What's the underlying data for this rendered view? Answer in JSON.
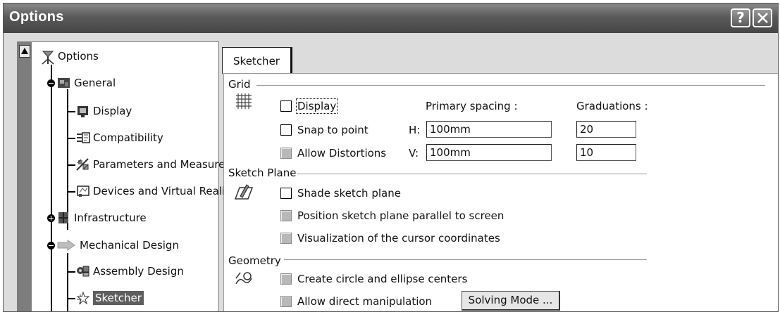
{
  "window": {
    "title": "Options",
    "help_label": "?",
    "close_label": "close"
  },
  "tree": {
    "root": "Options",
    "items": [
      {
        "label": "General",
        "icon": "general-icon"
      },
      {
        "label": "Display",
        "icon": "display-icon"
      },
      {
        "label": "Compatibility",
        "icon": "compatibility-icon"
      },
      {
        "label": "Parameters and Measure",
        "icon": "parameters-icon"
      },
      {
        "label": "Devices and Virtual Realit",
        "icon": "devices-icon"
      },
      {
        "label": "Infrastructure",
        "icon": "infrastructure-icon"
      },
      {
        "label": "Mechanical Design",
        "icon": "mechanical-design-icon"
      },
      {
        "label": "Assembly Design",
        "icon": "assembly-icon"
      },
      {
        "label": "Sketcher",
        "icon": "sketcher-icon",
        "selected": true
      }
    ]
  },
  "tab": {
    "label": "Sketcher"
  },
  "grid": {
    "title": "Grid",
    "display_label": "Display",
    "display_checked": false,
    "snap_label": "Snap to point",
    "snap_checked": false,
    "distortions_label": "Allow Distortions",
    "primary_spacing_label": "Primary spacing :",
    "graduations_label": "Graduations :",
    "h_label": "H:",
    "v_label": "V:",
    "h_value": "100mm",
    "v_value": "100mm",
    "h_graduations": "20",
    "v_graduations": "10"
  },
  "sketch_plane": {
    "title": "Sketch Plane",
    "shade_label": "Shade sketch plane",
    "shade_checked": false,
    "position_label": "Position sketch plane parallel to screen",
    "visualization_label": "Visualization of the cursor coordinates"
  },
  "geometry": {
    "title": "Geometry",
    "centers_label": "Create circle and ellipse centers",
    "manipulation_label": "Allow direct manipulation",
    "solving_mode_label": "Solving Mode ..."
  }
}
